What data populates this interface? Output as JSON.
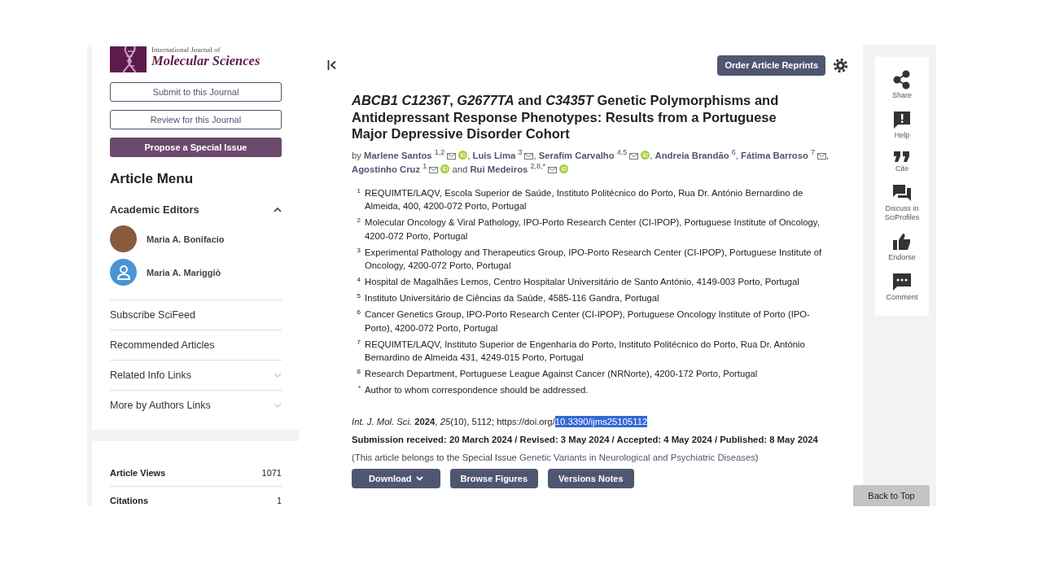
{
  "sidebar": {
    "journal_logo": {
      "line1": "International Journal of",
      "line2": "Molecular Sciences"
    },
    "buttons": [
      {
        "label": "Submit to this Journal",
        "kind": "outline"
      },
      {
        "label": "Review for this Journal",
        "kind": "outline"
      },
      {
        "label": "Propose a Special Issue",
        "kind": "primary"
      }
    ],
    "menu_title": "Article Menu",
    "editors_section": {
      "label": "Academic Editors",
      "expanded": true,
      "editors": [
        {
          "name": "Maria A. Bonifacio",
          "kind": "photo"
        },
        {
          "name": "Maria A. Mariggiò",
          "kind": "generic"
        }
      ]
    },
    "menu_items": [
      {
        "label": "Subscribe SciFeed",
        "kind": "link"
      },
      {
        "label": "Recommended Articles",
        "kind": "link"
      },
      {
        "label": "Related Info Links",
        "kind": "expandable",
        "expanded": false
      },
      {
        "label": "More by Authors Links",
        "kind": "expandable",
        "expanded": false
      }
    ],
    "stats": [
      {
        "label": "Article Views",
        "value": "1071"
      },
      {
        "label": "Citations",
        "value": "1"
      }
    ]
  },
  "article": {
    "order_button": "Order Article Reprints",
    "title": "*ABCB1 C1236T*, *G2677TA* and *C3435T* Genetic Polymorphisms and Antidepressant Response Phenotypes: Results from a Portuguese Major Depressive Disorder Cohort",
    "byline": [
      {
        "kind": "text",
        "text": "by "
      },
      {
        "kind": "author",
        "name": "Marlene Santos",
        "affil": "1,2",
        "email": true,
        "orcid": true
      },
      {
        "kind": "text",
        "text": ", "
      },
      {
        "kind": "author",
        "name": "Luis Lima",
        "affil": "3",
        "email": true,
        "orcid": false
      },
      {
        "kind": "text",
        "text": ", "
      },
      {
        "kind": "author",
        "name": "Serafim Carvalho",
        "affil": "4,5",
        "email": true,
        "orcid": true
      },
      {
        "kind": "text",
        "text": ", "
      },
      {
        "kind": "author",
        "name": "Andreia Brandão",
        "affil": "6",
        "email": false,
        "orcid": false
      },
      {
        "kind": "text",
        "text": ", "
      },
      {
        "kind": "author",
        "name": "Fátima Barroso",
        "affil": "7",
        "email": true,
        "orcid": false
      },
      {
        "kind": "text",
        "text": ", "
      },
      {
        "kind": "author",
        "name": "Agostinho Cruz",
        "affil": "1",
        "email": true,
        "orcid": true
      },
      {
        "kind": "text",
        "text": " and "
      },
      {
        "kind": "author",
        "name": "Rui Medeiros",
        "affil": "2,8,*",
        "email": true,
        "orcid": true
      }
    ],
    "affiliations": [
      {
        "mark": "1",
        "text": "REQUIMTE/LAQV, Escola Superior de Saúde, Instituto Politécnico do Porto, Rua Dr. António Bernardino de Almeida, 400, 4200-072 Porto, Portugal"
      },
      {
        "mark": "2",
        "text": "Molecular Oncology & Viral Pathology, IPO-Porto Research Center (CI-IPOP), Portuguese Institute of Oncology, 4200-072 Porto, Portugal"
      },
      {
        "mark": "3",
        "text": "Experimental Pathology and Therapeutics Group, IPO-Porto Research Center (CI-IPOP), Portuguese Institute of Oncology, 4200-072 Porto, Portugal"
      },
      {
        "mark": "4",
        "text": "Hospital de Magalhães Lemos, Centro Hospitalar Universitário de Santo António, 4149-003 Porto, Portugal"
      },
      {
        "mark": "5",
        "text": "Instituto Universitário de Ciências da Saúde, 4585-116 Gandra, Portugal"
      },
      {
        "mark": "6",
        "text": "Cancer Genetics Group, IPO-Porto Research Center (CI-IPOP), Portuguese Oncology Institute of Porto (IPO-Porto), 4200-072 Porto, Portugal"
      },
      {
        "mark": "7",
        "text": "REQUIMTE/LAQV, Instituto Superior de Engenharia do Porto, Instituto Politécnico do Porto, Rua Dr. António Bernardino de Almeida 431, 4249-015 Porto, Portugal"
      },
      {
        "mark": "8",
        "text": "Research Department, Portuguese League Against Cancer (NRNorte), 4200-172 Porto, Portugal"
      },
      {
        "mark": "*",
        "text": "Author to whom correspondence should be addressed."
      }
    ],
    "citation": {
      "text": "*Int. J. Mol. Sci.* **2024**, *25*(10), 5112; https://doi.org/",
      "doi": "10.3390/ijms25105112",
      "doi_selected": true
    },
    "dates": "Submission received: 20 March 2024 / Revised: 3 May 2024 / Accepted: 4 May 2024 / Published: 8 May 2024",
    "special_issue": {
      "prefix": "(This article belongs to the Special Issue ",
      "link": "Genetic Variants in Neurological and Psychiatric Diseases",
      "suffix": ")"
    },
    "actions": [
      {
        "label": "Download",
        "dropdown": true
      },
      {
        "label": "Browse Figures",
        "dropdown": false
      },
      {
        "label": "Versions Notes",
        "dropdown": false
      }
    ]
  },
  "tool_rail": {
    "items": [
      {
        "kind": "share",
        "label": "Share"
      },
      {
        "kind": "help",
        "label": "Help"
      },
      {
        "kind": "cite",
        "label": "Cite"
      },
      {
        "kind": "discuss",
        "label": "Discuss in SciProfiles"
      },
      {
        "kind": "endorse",
        "label": "Endorse"
      },
      {
        "kind": "comment",
        "label": "Comment"
      }
    ],
    "back_to_top": "Back to Top"
  }
}
